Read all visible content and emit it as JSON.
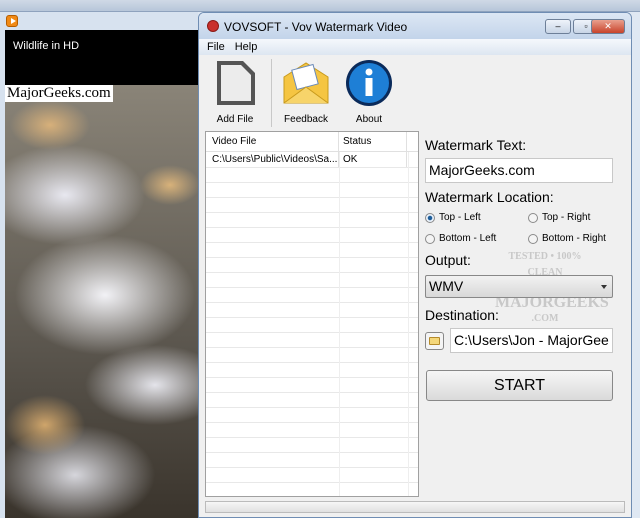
{
  "player": {
    "video_title": "Wildlife in HD",
    "overlay_watermark": "MajorGeeks.com"
  },
  "window": {
    "title": "VOVSOFT - Vov Watermark Video",
    "minimize": "‒",
    "maximize": "▫",
    "close": "✕"
  },
  "menu": [
    "File",
    "Help"
  ],
  "toolbar": {
    "add_file": "Add File",
    "feedback": "Feedback",
    "about": "About"
  },
  "list": {
    "columns": [
      "Video File",
      "Status"
    ],
    "rows": [
      {
        "file": "C:\\Users\\Public\\Videos\\Sa...",
        "status": "OK"
      }
    ]
  },
  "panel": {
    "watermark_text_label": "Watermark Text:",
    "watermark_text_value": "MajorGeeks.com",
    "location_label": "Watermark Location:",
    "locations": [
      {
        "label": "Top - Left",
        "selected": true
      },
      {
        "label": "Top - Right",
        "selected": false
      },
      {
        "label": "Bottom - Left",
        "selected": false
      },
      {
        "label": "Bottom - Right",
        "selected": false
      }
    ],
    "output_label": "Output:",
    "output_value": "WMV",
    "destination_label": "Destination:",
    "destination_value": "C:\\Users\\Jon - MajorGee",
    "start": "START"
  },
  "badge": {
    "line1": "TESTED • 100% CLEAN",
    "line2": "MAJORGEEKS",
    ".com": ".COM"
  }
}
